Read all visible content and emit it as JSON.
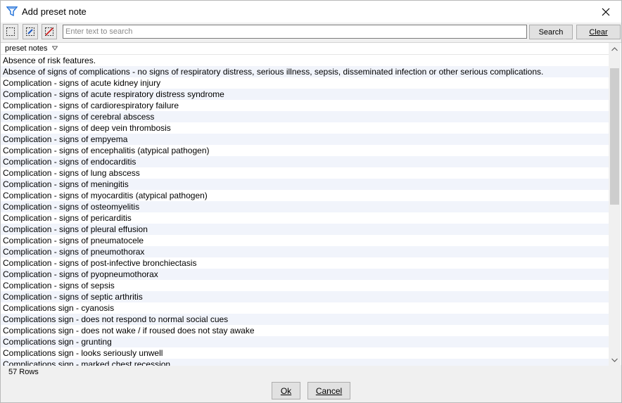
{
  "window": {
    "title": "Add preset note",
    "icons": {
      "app": "funnel-app-icon",
      "close": "close-icon"
    }
  },
  "toolbar": {
    "tools": [
      {
        "name": "select-all-icon"
      },
      {
        "name": "select-edit-icon"
      },
      {
        "name": "deselect-icon"
      }
    ],
    "search_placeholder": "Enter text to search",
    "search_value": "",
    "search_label": "Search",
    "clear_label": "Clear"
  },
  "list": {
    "column_header": "preset notes",
    "rows": [
      "Absence of risk features.",
      "Absence of signs of complications - no signs of respiratory distress, serious illness, sepsis, disseminated infection or other serious complications.",
      "Complication - signs of acute kidney injury",
      "Complication - signs of acute respiratory distress syndrome",
      "Complication - signs of cardiorespiratory failure",
      "Complication - signs of cerebral abscess",
      "Complication - signs of deep vein thrombosis",
      "Complication - signs of empyema",
      "Complication - signs of encephalitis (atypical pathogen)",
      "Complication - signs of endocarditis",
      "Complication - signs of lung abscess",
      "Complication - signs of meningitis",
      "Complication - signs of myocarditis (atypical pathogen)",
      "Complication - signs of osteomyelitis",
      "Complication - signs of pericarditis",
      "Complication - signs of pleural effusion",
      "Complication - signs of pneumatocele",
      "Complication - signs of pneumothorax",
      "Complication - signs of post-infective bronchiectasis",
      "Complication - signs of pyopneumothorax",
      "Complication - signs of sepsis",
      "Complication - signs of septic arthritis",
      "Complications sign - cyanosis",
      "Complications sign - does not respond to normal social cues",
      "Complications sign - does not wake / if roused does not stay awake",
      "Complications sign - grunting",
      "Complications sign - looks seriously unwell",
      "Complications sign - marked chest recession"
    ]
  },
  "status": {
    "row_count": "57 Rows"
  },
  "footer": {
    "ok_label": "Ok",
    "cancel_label": "Cancel"
  },
  "colors": {
    "row_alt": "#f1f4fb",
    "dialog_bg": "#f0f0f0",
    "app_icon": "#1e6fd9"
  }
}
